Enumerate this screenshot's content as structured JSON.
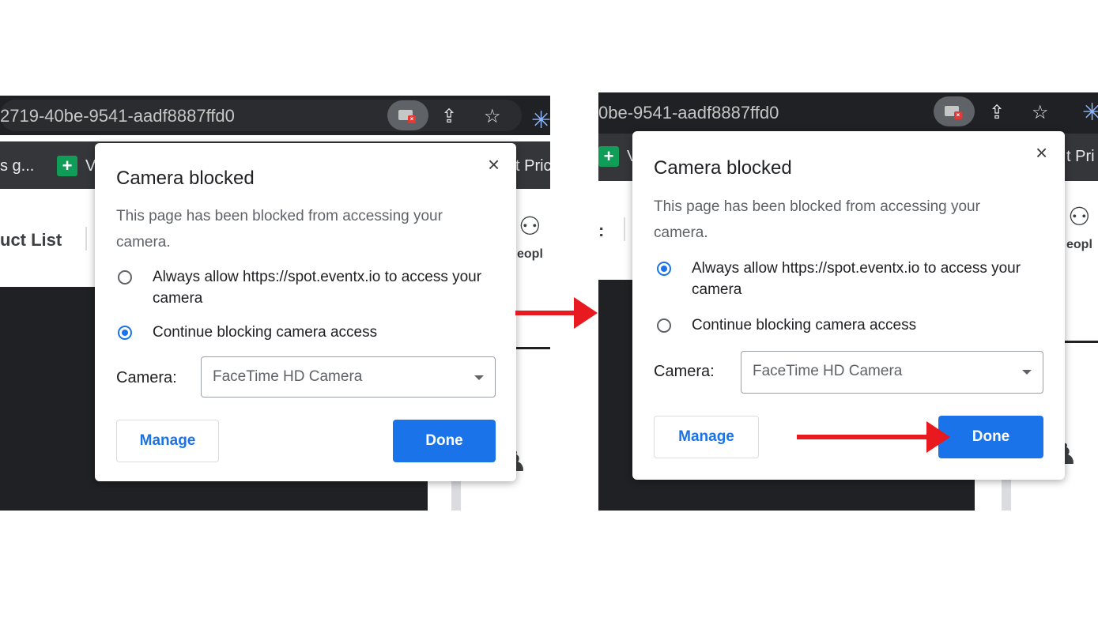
{
  "left_panel": {
    "url_fragment": "2719-40be-9541-aadf8887ffd0",
    "bookmark_fragment": "s g...",
    "bookmark_v": "V",
    "bookmark_right": "t Pric",
    "app_tab_label": "uct List",
    "people_label": "eopl",
    "dialog": {
      "title": "Camera blocked",
      "description": "This page has been blocked from accessing your camera.",
      "option_allow": "Always allow https://spot.eventx.io to access your camera",
      "option_block": "Continue blocking camera access",
      "selected_option": "block",
      "camera_label": "Camera:",
      "camera_value": "FaceTime HD Camera",
      "manage_label": "Manage",
      "done_label": "Done"
    }
  },
  "right_panel": {
    "url_fragment": "0be-9541-aadf8887ffd0",
    "bookmark_v": "V",
    "bookmark_right": "t Pri",
    "app_tab_label": ":",
    "people_label": "eopl",
    "dialog": {
      "title": "Camera blocked",
      "description": "This page has been blocked from accessing your camera.",
      "option_allow": "Always allow https://spot.eventx.io to access your camera",
      "option_block": "Continue blocking camera access",
      "selected_option": "allow",
      "camera_label": "Camera:",
      "camera_value": "FaceTime HD Camera",
      "manage_label": "Manage",
      "done_label": "Done"
    }
  },
  "icons": {
    "close": "×",
    "share": "⇪",
    "star": "☆",
    "extension": "✳",
    "people": "⚇",
    "sheets": "+"
  },
  "colors": {
    "accent_blue": "#1a73e8",
    "annotation_red": "#e8191f",
    "browser_dark": "#202124"
  }
}
